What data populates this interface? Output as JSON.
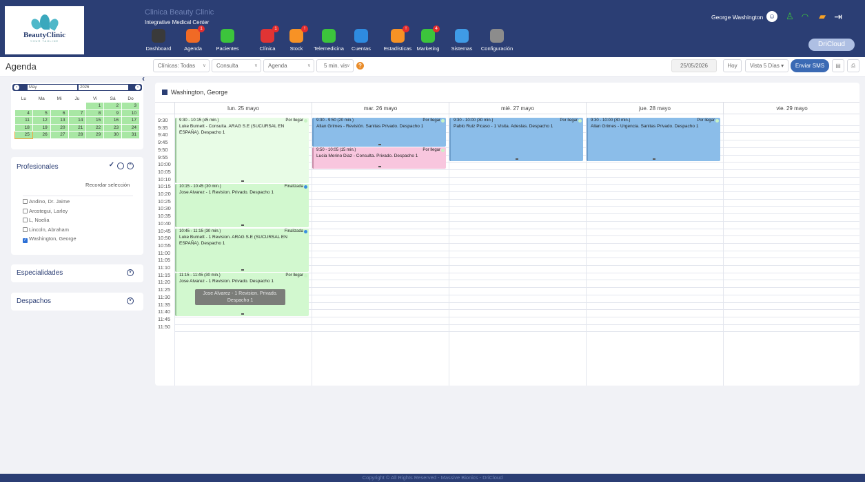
{
  "header": {
    "clinic_name": "Clinica Beauty Clinic",
    "clinic_sub": "Integrative Medical Center",
    "logo_brand": "BeautyClinic",
    "logo_sub": "YOUR TAGLINE",
    "user_name": "George Washington",
    "cloud_brand": "DriCloud"
  },
  "modules": [
    {
      "label": "Dashboard",
      "icon": "gauge-icon",
      "color": "#3a3a3a",
      "badge": ""
    },
    {
      "label": "Agenda",
      "icon": "phone-icon",
      "color": "#f06a25",
      "badge": "1"
    },
    {
      "label": "Pacientes",
      "icon": "person-icon",
      "color": "#3cc43c",
      "badge": ""
    },
    {
      "label": "Clínica",
      "icon": "clipboard-icon",
      "color": "#e03434",
      "badge": "1"
    },
    {
      "label": "Stock",
      "icon": "box-icon",
      "color": "#f79225",
      "badge": "!"
    },
    {
      "label": "Telemedicina",
      "icon": "chat-icon",
      "color": "#3cc43c",
      "badge": ""
    },
    {
      "label": "Cuentas",
      "icon": "wallet-icon",
      "color": "#2e8be0",
      "badge": ""
    },
    {
      "label": "Estadísticas",
      "icon": "bar-chart-icon",
      "color": "#f79225",
      "badge": "!"
    },
    {
      "label": "Marketing",
      "icon": "share-icon",
      "color": "#3cc43c",
      "badge": "4"
    },
    {
      "label": "Sistemas",
      "icon": "globe-icon",
      "color": "#3f9be6",
      "badge": ""
    },
    {
      "label": "Configuración",
      "icon": "gear-icon",
      "color": "#8c8c8c",
      "badge": ""
    }
  ],
  "subbar": {
    "page_title": "Agenda",
    "clinicas": "Clínicas: Todas",
    "consulta": "Consulta",
    "agenda": "Agenda",
    "interval": "5 min. vis",
    "date": "25/05/2026",
    "hoy": "Hoy",
    "vista": "Vista 5 Días",
    "sms": "Enviar SMS"
  },
  "mini_calendar": {
    "month": "May",
    "year": "2026",
    "weekdays": [
      "Lu",
      "Ma",
      "Mi",
      "Ju",
      "Vi",
      "Sá",
      "Do"
    ],
    "weeks": [
      [
        "",
        "",
        "",
        "",
        "1",
        "2",
        "3"
      ],
      [
        "4",
        "5",
        "6",
        "7",
        "8",
        "9",
        "10"
      ],
      [
        "11",
        "12",
        "13",
        "14",
        "15",
        "16",
        "17"
      ],
      [
        "18",
        "19",
        "20",
        "21",
        "22",
        "23",
        "24"
      ],
      [
        "25",
        "26",
        "27",
        "28",
        "29",
        "30",
        "31"
      ]
    ],
    "selected": "25"
  },
  "profesionales": {
    "title": "Profesionales",
    "remember": "Recordar selección",
    "items": [
      {
        "name": "Andino, Dr. Jaime",
        "checked": false
      },
      {
        "name": "Arostegui, Larley",
        "checked": false
      },
      {
        "name": "L, Noelia",
        "checked": false
      },
      {
        "name": "Lincoln, Abraham",
        "checked": false
      },
      {
        "name": "Washington, George",
        "checked": true
      }
    ]
  },
  "especialidades": {
    "title": "Especialidades"
  },
  "despachos": {
    "title": "Despachos"
  },
  "scheduler": {
    "title": "Washington, George",
    "days": [
      "lun. 25 mayo",
      "mar. 26 mayo",
      "mié. 27 mayo",
      "jue. 28 mayo",
      "vie. 29 mayo"
    ],
    "times": [
      "9:30",
      "9:35",
      "9:40",
      "9:45",
      "9:50",
      "9:55",
      "10:00",
      "10:05",
      "10:10",
      "10:15",
      "10:20",
      "10:25",
      "10:30",
      "10:35",
      "10:40",
      "10:45",
      "10:50",
      "10:55",
      "11:00",
      "11:05",
      "11:10",
      "11:15",
      "11:20",
      "11:25",
      "11:30",
      "11:35",
      "11:40",
      "11:45",
      "11:50"
    ],
    "appointments": [
      {
        "day": 0,
        "start": 0,
        "slots": 9,
        "style": "g light",
        "time": "9:30 - 10:15 (45 min.)",
        "status": "Por llegar",
        "dot": "#c8f3c4",
        "desc": "Luke Burnett - Consulta. ARAG S.E (SUCURSAL EN ESPAÑA). Despacho 1"
      },
      {
        "day": 0,
        "start": 9,
        "slots": 6,
        "style": "g",
        "time": "10:15 - 10:45 (30 min.)",
        "status": "Finalizada",
        "dot": "#3a8ee0",
        "desc": "Jose Alvarez - 1 Revision. Privado. Despacho 1"
      },
      {
        "day": 0,
        "start": 15,
        "slots": 6,
        "style": "g",
        "time": "10:45 - 11:15 (30 min.)",
        "status": "Finalizada",
        "dot": "#3a8ee0",
        "desc": "Luke Burnett - 1 Revision. ARAG S.E (SUCURSAL EN ESPAÑA). Despacho 1"
      },
      {
        "day": 0,
        "start": 21,
        "slots": 6,
        "style": "g",
        "time": "11:15 - 11:45 (30 min.)",
        "status": "Por llegar",
        "dot": "#c8f3c4",
        "desc": "Jose Alvarez - 1 Revision. Privado. Despacho 1"
      },
      {
        "day": 1,
        "start": 0,
        "slots": 4,
        "style": "b",
        "time": "9:30 - 9:50 (20 min.)",
        "status": "Por llegar",
        "dot": "#c8f3c4",
        "desc": "Allan Grimes - Revisión. Sanitas Privado. Despacho 1"
      },
      {
        "day": 1,
        "start": 4,
        "slots": 3,
        "style": "p",
        "time": "9:50 - 10:05 (15 min.)",
        "status": "Por llegar",
        "dot": "#c8f3c4",
        "desc": "Lucia Merino Diaz - Consulta. Privado. Despacho 1"
      },
      {
        "day": 2,
        "start": 0,
        "slots": 6,
        "style": "b",
        "time": "9:30 - 10:00 (30 min.)",
        "status": "Por llegar",
        "dot": "#c8f3c4",
        "desc": "Pablo Ruiz Picaso - 1 Visita. Adeslas. Despacho 1"
      },
      {
        "day": 3,
        "start": 0,
        "slots": 6,
        "style": "b",
        "time": "9:30 - 10:00 (30 min.)",
        "status": "Por llegar",
        "dot": "#c8f3c4",
        "desc": "Allan Grimes - Urgencia. Sanitas Privado. Despacho 1"
      }
    ],
    "drag_tip": "Jose Alvarez - 1 Revision. Privado. Despacho 1"
  },
  "footer": "Copyright © All Rights Reserved - Massive Bionics - DriCloud"
}
